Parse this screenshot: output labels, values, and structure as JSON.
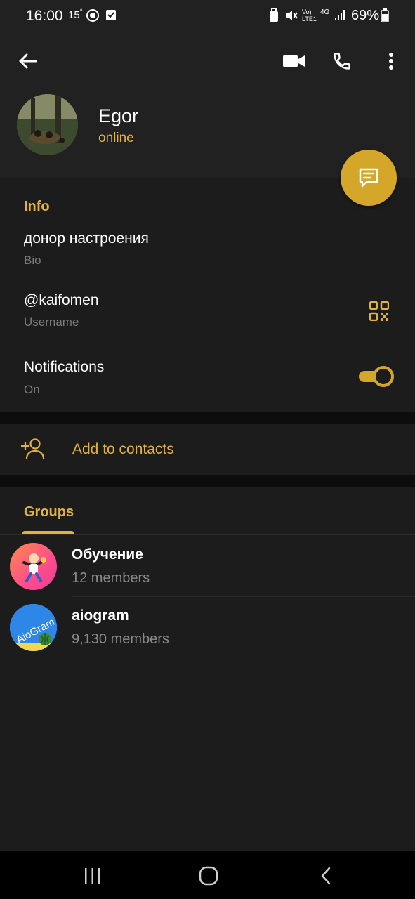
{
  "status_bar": {
    "time": "16:00",
    "temperature": "15",
    "temperature_unit": "°",
    "volte_label": "Vo) LTE1",
    "network_label": "4G",
    "battery": "69%"
  },
  "toolbar": {
    "back_icon": "arrow-left-icon",
    "video_call_icon": "video-camera-icon",
    "call_icon": "phone-icon",
    "menu_icon": "more-vertical-icon"
  },
  "profile": {
    "name": "Egor",
    "status": "online"
  },
  "info": {
    "title": "Info",
    "bio_value": "донор настроения",
    "bio_label": "Bio",
    "username_value": "@kaifomen",
    "username_label": "Username",
    "notifications_value": "Notifications",
    "notifications_label": "On",
    "notifications_enabled": true
  },
  "actions": {
    "add_contacts_label": "Add to contacts"
  },
  "groups": {
    "tab_label": "Groups",
    "items": [
      {
        "name": "Обучение",
        "members": "12 members"
      },
      {
        "name": "aiogram",
        "members": "9,130 members"
      }
    ]
  },
  "colors": {
    "accent": "#e2b33c",
    "fab": "#d4a62a",
    "background": "#1c1c1c",
    "header": "#212121"
  }
}
